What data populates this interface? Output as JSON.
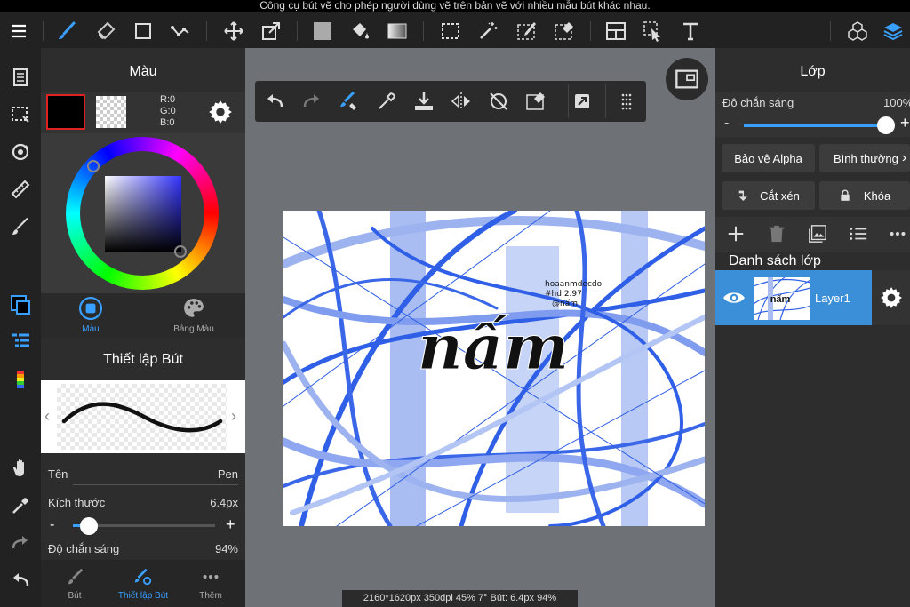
{
  "status_text": "Công cụ bút vẽ cho phép người dùng vẽ trên bản vẽ với nhiều mẫu bút khác nhau.",
  "color_panel": {
    "title": "Màu",
    "rgb": {
      "r": "R:0",
      "g": "G:0",
      "b": "B:0"
    },
    "tabs": [
      {
        "label": "Màu"
      },
      {
        "label": "Bảng Màu"
      }
    ]
  },
  "brush_panel": {
    "title": "Thiết lập Bút",
    "name_label": "Tên",
    "name_value": "Pen",
    "size_label": "Kích thước",
    "size_value": "6.4px",
    "size_minus": "-",
    "size_plus": "+",
    "opacity_label": "Độ chắn sáng",
    "opacity_value": "94%",
    "bottom_tabs": [
      {
        "label": "Bút"
      },
      {
        "label": "Thiết lập Bút"
      },
      {
        "label": "Thêm"
      }
    ]
  },
  "canvas": {
    "status_text": "2160*1620px 350dpi 45% 7° Bút: 6.4px 94%",
    "art_text": "nấm",
    "signature_lines": [
      "hoaanmdecdo",
      "#hd 2.97",
      "@nấm"
    ]
  },
  "layer_panel": {
    "title": "Lớp",
    "opacity_label": "Độ chắn sáng",
    "opacity_value": "100%",
    "opacity_minus": "-",
    "opacity_plus": "+",
    "alpha_protect": "Bảo vệ Alpha",
    "blend_mode": "Bình thường",
    "clipping": "Cắt xén",
    "lock": "Khóa",
    "list_title": "Danh sách lớp",
    "layers": [
      {
        "name": "Layer1"
      }
    ]
  },
  "colors": {
    "accent": "#1e90ff",
    "layer_selected": "#3a8fd8",
    "canvas_bg": "#6e7176",
    "stroke_blue": "#2f5fe6"
  }
}
